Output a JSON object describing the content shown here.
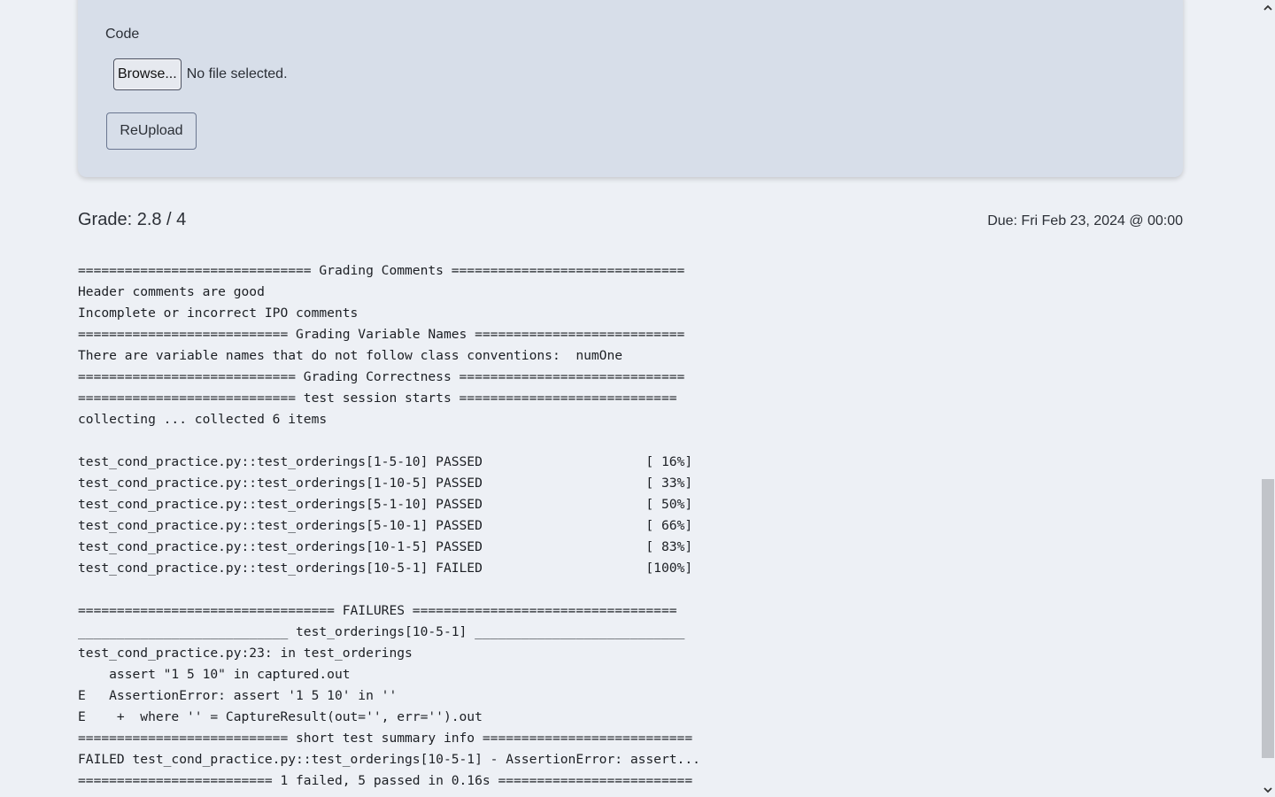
{
  "upload": {
    "label": "Code",
    "browse_label": "Browse...",
    "file_status": "No file selected.",
    "reupload_label": "ReUpload"
  },
  "grade": {
    "text": "Grade: 2.8 / 4",
    "due": "Due: Fri Feb 23, 2024 @ 00:00"
  },
  "output_lines": [
    "============================== Grading Comments ==============================",
    "Header comments are good",
    "Incomplete or incorrect IPO comments",
    "=========================== Grading Variable Names ===========================",
    "There are variable names that do not follow class conventions:  numOne",
    "============================ Grading Correctness =============================",
    "============================ test session starts ============================",
    "collecting ... collected 6 items",
    "",
    "test_cond_practice.py::test_orderings[1-5-10] PASSED                     [ 16%]",
    "test_cond_practice.py::test_orderings[1-10-5] PASSED                     [ 33%]",
    "test_cond_practice.py::test_orderings[5-1-10] PASSED                     [ 50%]",
    "test_cond_practice.py::test_orderings[5-10-1] PASSED                     [ 66%]",
    "test_cond_practice.py::test_orderings[10-1-5] PASSED                     [ 83%]",
    "test_cond_practice.py::test_orderings[10-5-1] FAILED                     [100%]",
    "",
    "================================= FAILURES ==================================",
    "___________________________ test_orderings[10-5-1] ___________________________",
    "test_cond_practice.py:23: in test_orderings",
    "    assert \"1 5 10\" in captured.out",
    "E   AssertionError: assert '1 5 10' in ''",
    "E    +  where '' = CaptureResult(out='', err='').out",
    "=========================== short test summary info ===========================",
    "FAILED test_cond_practice.py::test_orderings[10-5-1] - AssertionError: assert...",
    "========================= 1 failed, 5 passed in 0.16s ========================="
  ],
  "scrollbar": {
    "up_icon": "chevron-up-icon",
    "down_icon": "chevron-down-icon"
  }
}
